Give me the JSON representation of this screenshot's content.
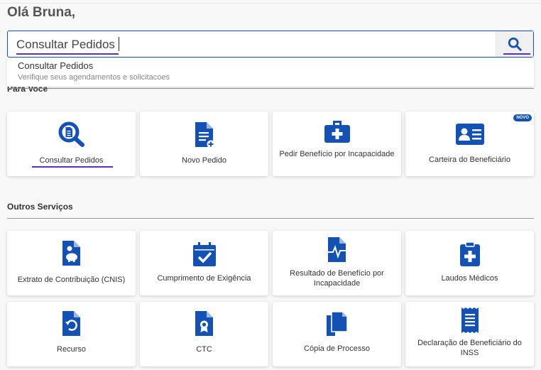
{
  "greeting": "Olá Bruna,",
  "search": {
    "value": "Consultar Pedidos",
    "button_icon": "search-icon"
  },
  "suggestion": {
    "title": "Consultar Pedidos",
    "subtitle": "Verifique seus agendamentos e solicitacoes"
  },
  "sections": {
    "para_voce": "Para Você",
    "outros": "Outros Serviços"
  },
  "colors": {
    "primary": "#1351b4",
    "highlight": "#5b2fc9"
  },
  "para_voce_cards": [
    {
      "label": "Consultar Pedidos",
      "icon": "magnifier-document-icon"
    },
    {
      "label": "Novo Pedido",
      "icon": "document-add-icon"
    },
    {
      "label": "Pedir Benefício por Incapacidade",
      "icon": "medical-kit-icon"
    },
    {
      "label": "Carteira do Beneficiário",
      "icon": "id-card-icon",
      "badge": "NOVO"
    }
  ],
  "outros_cards": [
    {
      "label": "Extrato de Contribuição (CNIS)",
      "icon": "piggy-bank-document-icon"
    },
    {
      "label": "Cumprimento de Exigência",
      "icon": "calendar-check-icon"
    },
    {
      "label": "Resultado de Benefício por Incapacidade",
      "icon": "heartbeat-document-icon"
    },
    {
      "label": "Laudos Médicos",
      "icon": "medical-clipboard-icon"
    },
    {
      "label": "Recurso",
      "icon": "undo-document-icon"
    },
    {
      "label": "CTC",
      "icon": "certificate-document-icon"
    },
    {
      "label": "Cópia de Processo",
      "icon": "copy-documents-icon"
    },
    {
      "label": "Declaração de Beneficiário do INSS",
      "icon": "receipt-icon"
    }
  ]
}
